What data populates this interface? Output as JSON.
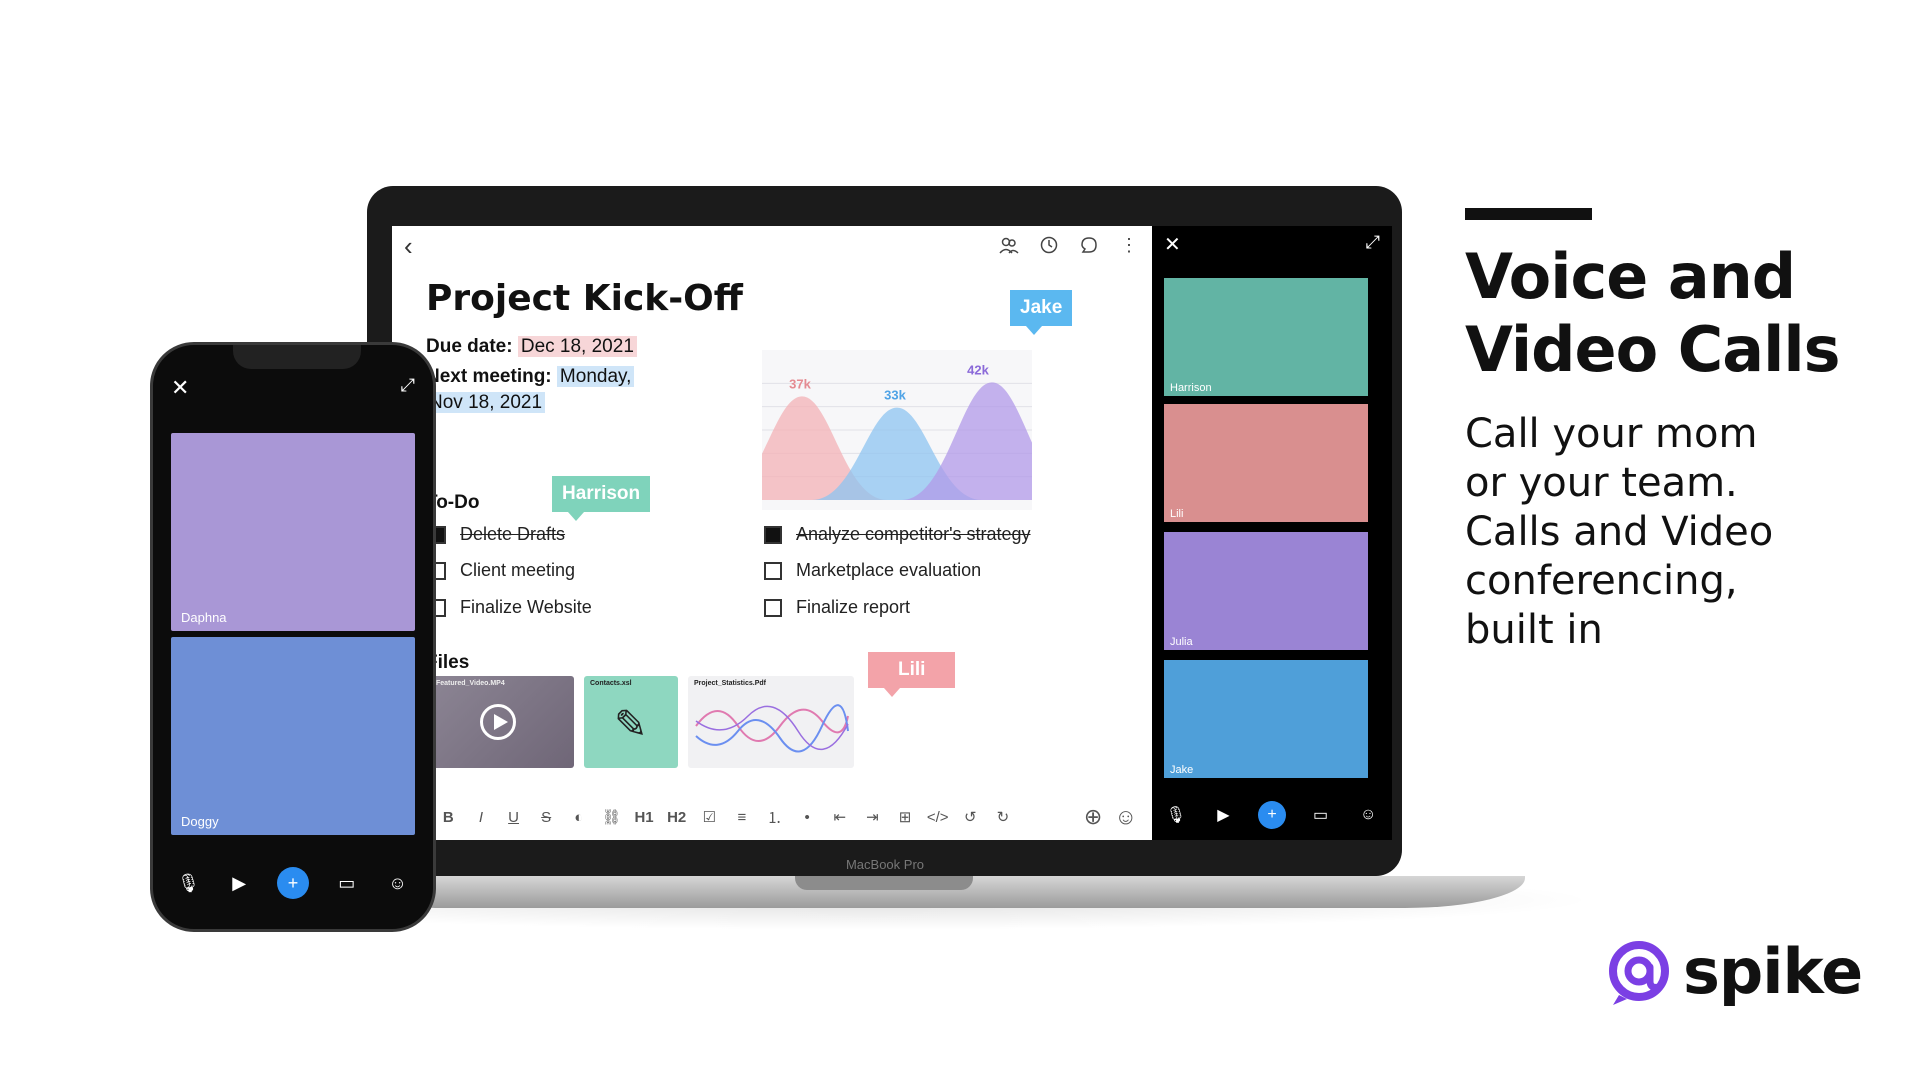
{
  "headline": {
    "line1": "Voice and",
    "line2": "Video Calls"
  },
  "tagline": {
    "line1": "Call your mom",
    "line2": "or your team.",
    "line3": "Calls and Video",
    "line4": "conferencing,",
    "line5": "built in"
  },
  "brand": {
    "name": "spike",
    "color": "#7b3fe4"
  },
  "laptop": {
    "model_label": "MacBook Pro"
  },
  "document": {
    "title": "Project Kick-Off",
    "due_label": "Due date:",
    "due_value": "Dec 18, 2021",
    "next_label": "Next meeting:",
    "next_value_line1": "Monday,",
    "next_value_line2": "Nov 18, 2021",
    "todo_title": "To-Do",
    "files_title": "Files",
    "todos": [
      {
        "label": "Delete Drafts",
        "done": true
      },
      {
        "label": "Client meeting",
        "done": false
      },
      {
        "label": "Finalize Website",
        "done": false
      },
      {
        "label": "Analyze competitor's strategy",
        "done": true
      },
      {
        "label": "Marketplace evaluation",
        "done": false
      },
      {
        "label": "Finalize report",
        "done": false
      }
    ],
    "files": [
      {
        "name": "Featured_Video.MP4",
        "icon": "play-icon"
      },
      {
        "name": "Contacts.xsl",
        "icon": "pencil-icon"
      },
      {
        "name": "Project_Statistics.Pdf",
        "icon": "chart-thumbnail"
      }
    ],
    "collaborators": {
      "jake": "Jake",
      "harrison": "Harrison",
      "lili": "Lili"
    }
  },
  "chart_data": {
    "type": "area",
    "series": [
      {
        "name": "",
        "peak_label": "37k",
        "peak": 37,
        "color": "#f3b1b6"
      },
      {
        "name": "",
        "peak_label": "33k",
        "peak": 33,
        "color": "#8ec4f0"
      },
      {
        "name": "",
        "peak_label": "42k",
        "peak": 42,
        "color": "#b19ae8"
      }
    ],
    "ylim": [
      0,
      50
    ],
    "grid": true
  },
  "toolbar": {
    "bold": "B",
    "italic": "I",
    "underline": "U",
    "strike": "S",
    "h1": "H1",
    "h2": "H2"
  },
  "call_panel": {
    "participants": [
      {
        "name": "Harrison",
        "bg": "#62b4a4"
      },
      {
        "name": "Lili",
        "bg": "#d98f8f"
      },
      {
        "name": "Julia",
        "bg": "#9a84d4"
      },
      {
        "name": "Jake",
        "bg": "#4f9fd9"
      }
    ],
    "accent": "#2a8cf0"
  },
  "phone": {
    "participants": [
      {
        "name": "Daphna",
        "bg": "#a997d6"
      },
      {
        "name": "Doggy",
        "bg": "#6e8fd6"
      }
    ]
  }
}
